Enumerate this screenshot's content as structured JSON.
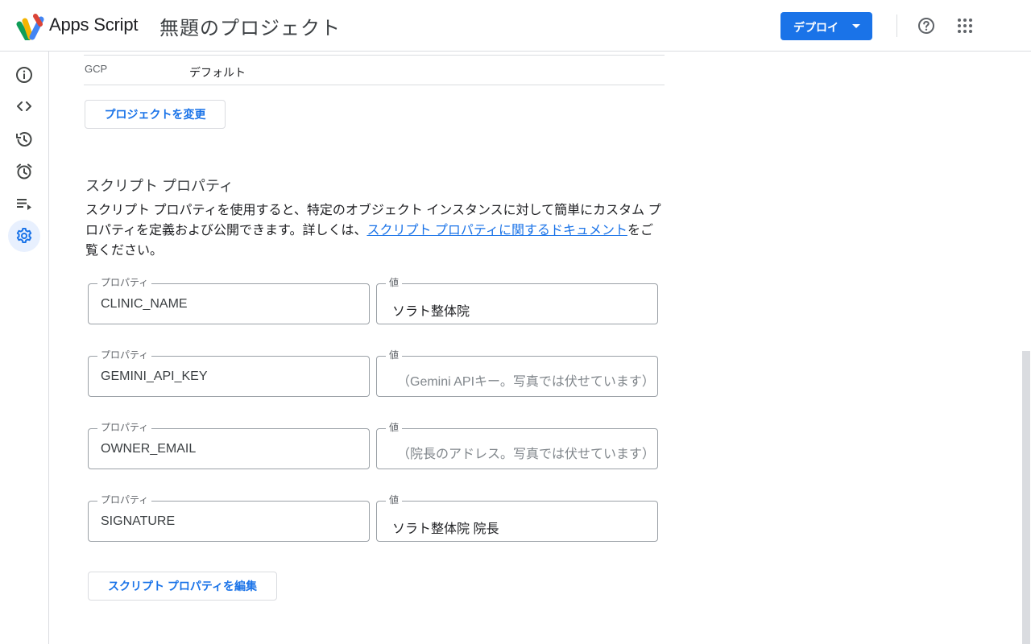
{
  "header": {
    "app_name": "Apps Script",
    "project_title": "無題のプロジェクト",
    "deploy_label": "デプロイ"
  },
  "rail": {
    "items": [
      {
        "icon": "info-icon"
      },
      {
        "icon": "code-icon"
      },
      {
        "icon": "history-icon"
      },
      {
        "icon": "alarm-icon"
      },
      {
        "icon": "executions-icon"
      },
      {
        "icon": "gear-icon",
        "active": true
      }
    ]
  },
  "gcp": {
    "label": "GCP",
    "value": "デフォルト",
    "change_button": "プロジェクトを変更"
  },
  "script_properties": {
    "title": "スクリプト プロパティ",
    "desc_before": "スクリプト プロパティを使用すると、特定のオブジェクト インスタンスに対して簡単にカスタム プロパティを定義および公開できます。詳しくは、",
    "desc_link": "スクリプト プロパティに関するドキュメント",
    "desc_after": "をご覧ください。",
    "property_label": "プロパティ",
    "value_label": "値",
    "rows": [
      {
        "key": "CLINIC_NAME",
        "value": "ソラト整体院"
      },
      {
        "key": "GEMINI_API_KEY",
        "value": "（Gemini APIキー。写真では伏せています）"
      },
      {
        "key": "OWNER_EMAIL",
        "value": "（院長のアドレス。写真では伏せています）"
      },
      {
        "key": "SIGNATURE",
        "value": "ソラト整体院 院長"
      }
    ],
    "edit_button": "スクリプト プロパティを編集"
  },
  "colors": {
    "accent": "#1a73e8",
    "active_rail_bg": "#e8f0fe",
    "border": "#dadce0"
  }
}
